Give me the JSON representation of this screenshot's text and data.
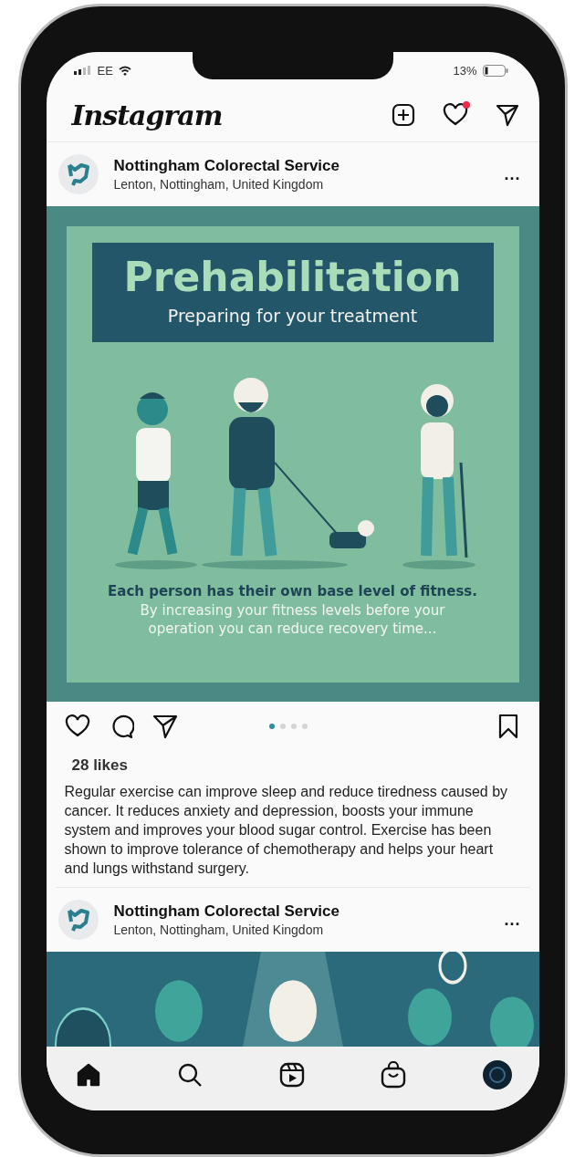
{
  "status_bar": {
    "carrier": "EE",
    "battery": "13%"
  },
  "header": {
    "logo": "Instagram",
    "notifications_unread": true
  },
  "posts": [
    {
      "account": "Nottingham Colorectal Service",
      "location": "Lenton, Nottingham, United Kingdom",
      "more": "...",
      "image": {
        "title": "Prehabilitation",
        "subtitle": "Preparing for your treatment",
        "lead": "Each person has their own base level of fitness.",
        "body": "By increasing your fitness levels before your operation you can reduce recovery time..."
      },
      "carousel_dots": [
        {
          "selected": true
        },
        {
          "selected": false
        },
        {
          "selected": false
        },
        {
          "selected": false
        }
      ],
      "likes": "28 likes",
      "caption": "Regular exercise can improve sleep and reduce tiredness caused by cancer. It reduces anxiety and depression, boosts your immune system and improves your blood sugar control. Exercise has been shown to improve tolerance of chemotherapy and helps your heart and lungs withstand surgery."
    },
    {
      "account": "Nottingham Colorectal Service",
      "location": "Lenton, Nottingham, United Kingdom",
      "more": "..."
    }
  ],
  "bottom_nav": [
    {
      "kind": "home",
      "selected": true
    },
    {
      "kind": "search",
      "selected": false
    },
    {
      "kind": "reels",
      "selected": false
    },
    {
      "kind": "shop",
      "selected": false
    },
    {
      "kind": "profile",
      "selected": false
    }
  ]
}
